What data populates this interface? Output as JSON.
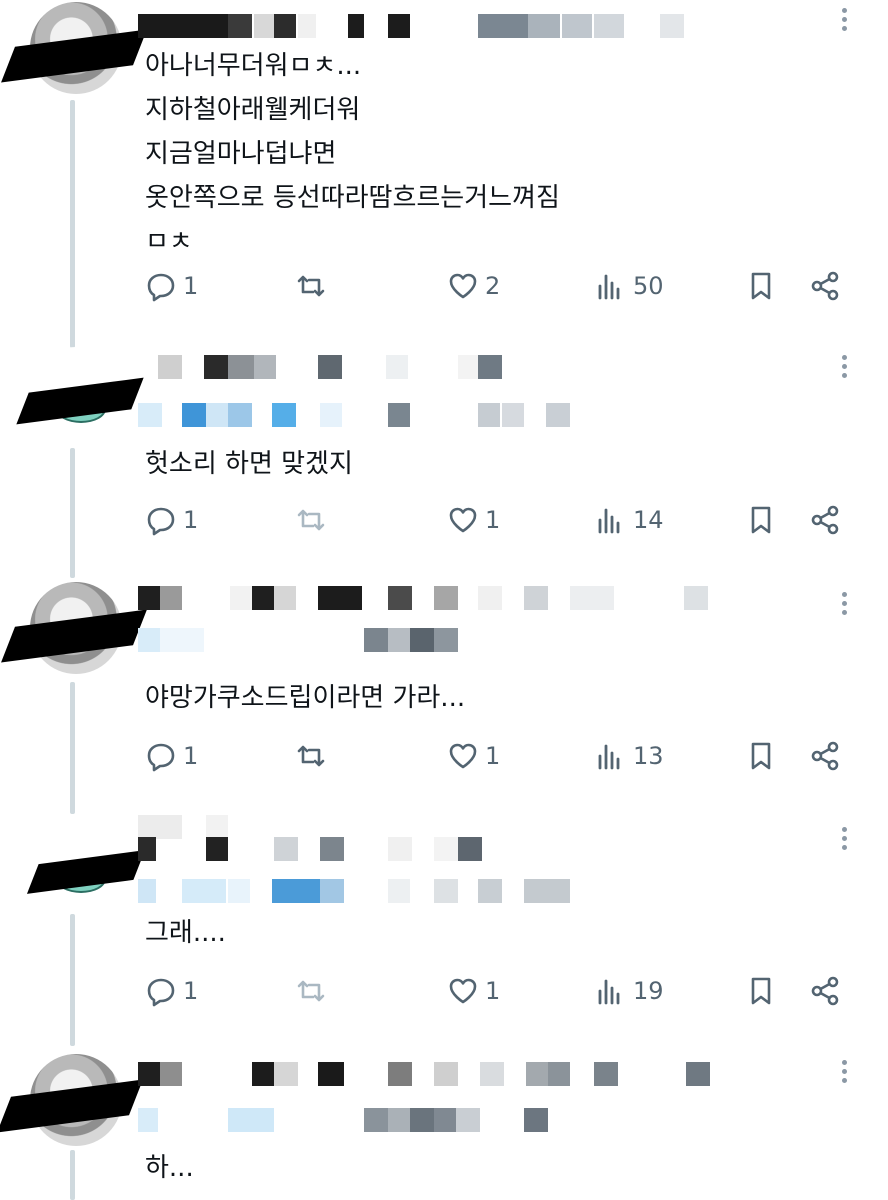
{
  "tweets": [
    {
      "text": "아나너무더워ㅁㅊ...\n지하철아래웰케더워\n지금얼마나덥냐면\n옷안쪽으로 등선따라땀흐르는거느껴짐\nㅁㅊ",
      "replies": "1",
      "likes": "2",
      "views": "50",
      "retweet_dimmed": false
    },
    {
      "text": "헛소리 하면 맞겠지",
      "replies": "1",
      "likes": "1",
      "views": "14",
      "retweet_dimmed": true
    },
    {
      "text": "야망가쿠소드립이라면 가라...",
      "replies": "1",
      "likes": "1",
      "views": "13",
      "retweet_dimmed": false
    },
    {
      "text": "그래....",
      "replies": "1",
      "likes": "1",
      "views": "19",
      "retweet_dimmed": true
    },
    {
      "text": "하..."
    }
  ],
  "icons": {
    "reply": "reply-icon",
    "retweet": "retweet-icon",
    "like": "heart-icon",
    "views": "views-icon",
    "bookmark": "bookmark-icon",
    "share": "share-icon",
    "more": "more-icon"
  },
  "colors": {
    "icon": "#536471",
    "dimmed": "#aab8c2",
    "thread_line": "#cfd9de"
  }
}
